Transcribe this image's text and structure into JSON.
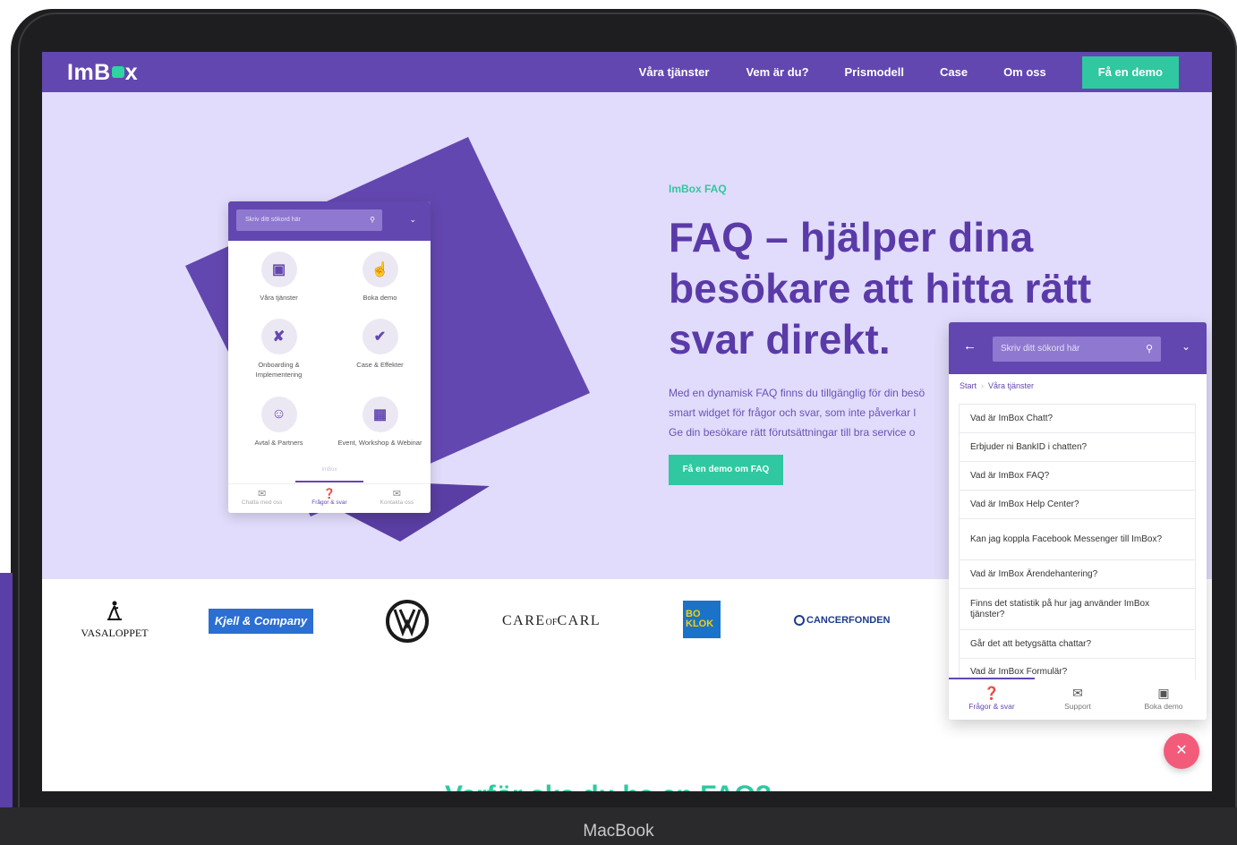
{
  "device": {
    "label": "MacBook"
  },
  "nav": {
    "logo_left": "ImB",
    "logo_right": "x",
    "links": [
      "Våra tjänster",
      "Vem är du?",
      "Prismodell",
      "Case",
      "Om oss"
    ],
    "cta": "Få en demo"
  },
  "hero": {
    "eyebrow": "ImBox FAQ",
    "headline": "FAQ – hjälper dina besökare att hitta rätt svar direkt.",
    "body_lines": [
      "Med en dynamisk FAQ finns du tillgänglig för din besö",
      "smart widget för frågor och svar, som inte påverkar l",
      "Ge din besökare rätt förutsättningar till bra service o"
    ],
    "cta": "Få en demo om FAQ"
  },
  "widget_small": {
    "search_placeholder": "Skriv ditt sökord här",
    "items": [
      {
        "label": "Våra tjänster",
        "icon": "chat-square-icon"
      },
      {
        "label": "Boka demo",
        "icon": "pointer-hand-icon"
      },
      {
        "label": "Onboarding & Implementering",
        "icon": "tools-icon"
      },
      {
        "label": "Case & Effekter",
        "icon": "badge-check-icon"
      },
      {
        "label": "Avtal & Partners",
        "icon": "handshake-icon"
      },
      {
        "label": "Event, Workshop & Webinar",
        "icon": "calendar-icon"
      }
    ],
    "mini_brand": "ImBox",
    "tabs": [
      {
        "label": "Chatta med oss",
        "icon": "chat-bubbles-icon"
      },
      {
        "label": "Frågor & svar",
        "icon": "question-circle-icon"
      },
      {
        "label": "Kontakta oss",
        "icon": "mail-icon"
      }
    ]
  },
  "logos": {
    "vasaloppet": "VASALOPPET",
    "kjell": "Kjell & Company",
    "care_left": "CARE",
    "care_of": "OF",
    "care_right": "CARL",
    "boklok_1": "BO",
    "boklok_2": "KLOK",
    "cancerfonden": "CANCERFONDEN"
  },
  "bottom_heading": "Varför ska du ha en FAQ?",
  "widget_large": {
    "search_placeholder": "Skriv ditt sökord här",
    "breadcrumb": {
      "start": "Start",
      "current": "Våra tjänster"
    },
    "questions": [
      "Vad är ImBox Chatt?",
      "Erbjuder ni BankID i chatten?",
      "Vad är ImBox FAQ?",
      "Vad är ImBox Help Center?",
      "Kan jag koppla Facebook Messenger till ImBox?",
      "Vad är ImBox Ärendehantering?",
      "Finns det statistik på hur jag använder ImBox tjänster?",
      "Går det att betygsätta chattar?",
      "Vad är ImBox Formulär?"
    ],
    "tabs": [
      {
        "label": "Frågor & svar",
        "icon": "question-circle-icon"
      },
      {
        "label": "Support",
        "icon": "mail-icon"
      },
      {
        "label": "Boka demo",
        "icon": "chat-square-icon"
      }
    ]
  },
  "colors": {
    "brand_purple": "#6347b0",
    "accent_green": "#2fc8a0",
    "hero_bg": "#e1dcfb",
    "close_pink": "#f25c7a"
  }
}
